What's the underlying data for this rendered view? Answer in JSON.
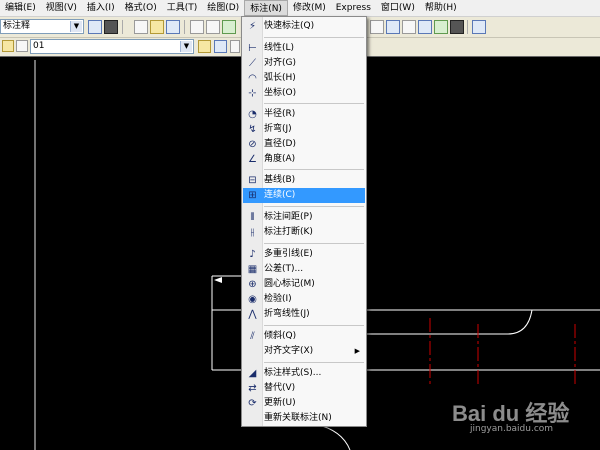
{
  "menu": {
    "items": [
      {
        "label": "编辑(E)"
      },
      {
        "label": "视图(V)"
      },
      {
        "label": "插入(I)"
      },
      {
        "label": "格式(O)"
      },
      {
        "label": "工具(T)"
      },
      {
        "label": "绘图(D)"
      },
      {
        "label": "标注(N)",
        "active": true
      },
      {
        "label": "修改(M)"
      },
      {
        "label": "Express"
      },
      {
        "label": "窗口(W)"
      },
      {
        "label": "帮助(H)"
      }
    ]
  },
  "toolbar": {
    "style_combo": "标注释",
    "layer_combo": "01"
  },
  "dimension_menu": {
    "quick": "快速标注(Q)",
    "linear": "线性(L)",
    "aligned": "对齐(G)",
    "arc_length": "弧长(H)",
    "ordinate": "坐标(O)",
    "radius": "半径(R)",
    "jogged": "折弯(J)",
    "diameter": "直径(D)",
    "angular": "角度(A)",
    "baseline": "基线(B)",
    "continue": "连续(C)",
    "space": "标注间距(P)",
    "break": "标注打断(K)",
    "mleader": "多重引线(E)",
    "tolerance": "公差(T)...",
    "center_mark": "圆心标记(M)",
    "inspection": "检验(I)",
    "jogged_linear": "折弯线性(J)",
    "oblique": "倾斜(Q)",
    "align_text": "对齐文字(X)",
    "dim_style": "标注样式(S)...",
    "override": "替代(V)",
    "update": "更新(U)",
    "reassociate": "重新关联标注(N)",
    "selected": "continue"
  },
  "watermark": {
    "logo": "Bai du 经验",
    "url": "jingyan.baidu.com"
  },
  "colors": {
    "accent": "#3399ff",
    "canvas": "#000000",
    "center_line": "#cc0000"
  }
}
